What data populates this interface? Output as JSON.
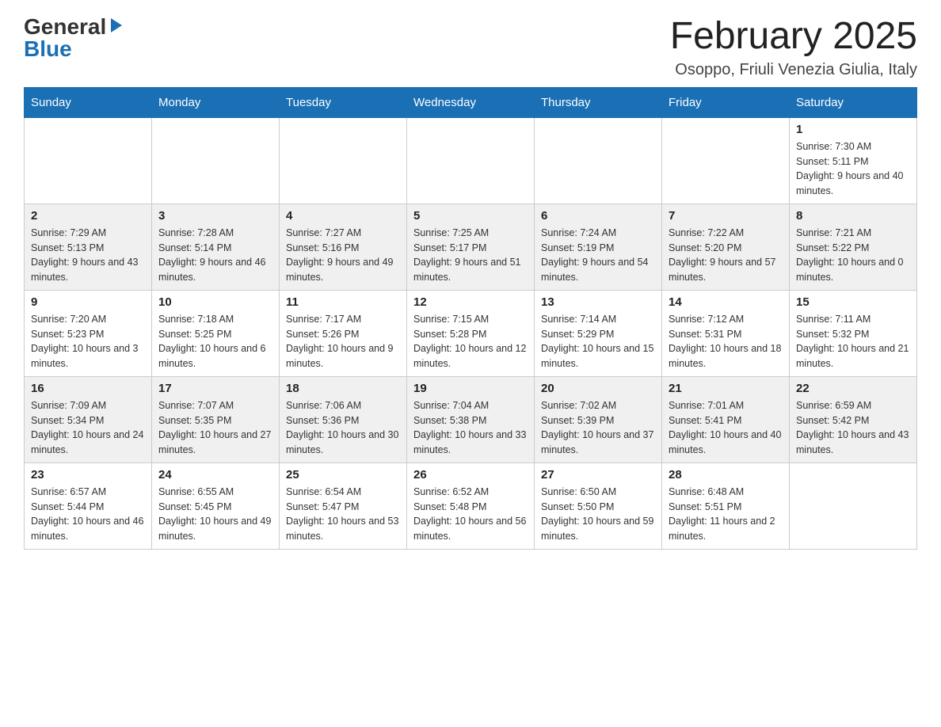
{
  "logo": {
    "general": "General",
    "blue": "Blue",
    "arrow": "▶"
  },
  "title": "February 2025",
  "subtitle": "Osoppo, Friuli Venezia Giulia, Italy",
  "headers": [
    "Sunday",
    "Monday",
    "Tuesday",
    "Wednesday",
    "Thursday",
    "Friday",
    "Saturday"
  ],
  "weeks": [
    [
      {
        "day": "",
        "info": ""
      },
      {
        "day": "",
        "info": ""
      },
      {
        "day": "",
        "info": ""
      },
      {
        "day": "",
        "info": ""
      },
      {
        "day": "",
        "info": ""
      },
      {
        "day": "",
        "info": ""
      },
      {
        "day": "1",
        "info": "Sunrise: 7:30 AM\nSunset: 5:11 PM\nDaylight: 9 hours and 40 minutes."
      }
    ],
    [
      {
        "day": "2",
        "info": "Sunrise: 7:29 AM\nSunset: 5:13 PM\nDaylight: 9 hours and 43 minutes."
      },
      {
        "day": "3",
        "info": "Sunrise: 7:28 AM\nSunset: 5:14 PM\nDaylight: 9 hours and 46 minutes."
      },
      {
        "day": "4",
        "info": "Sunrise: 7:27 AM\nSunset: 5:16 PM\nDaylight: 9 hours and 49 minutes."
      },
      {
        "day": "5",
        "info": "Sunrise: 7:25 AM\nSunset: 5:17 PM\nDaylight: 9 hours and 51 minutes."
      },
      {
        "day": "6",
        "info": "Sunrise: 7:24 AM\nSunset: 5:19 PM\nDaylight: 9 hours and 54 minutes."
      },
      {
        "day": "7",
        "info": "Sunrise: 7:22 AM\nSunset: 5:20 PM\nDaylight: 9 hours and 57 minutes."
      },
      {
        "day": "8",
        "info": "Sunrise: 7:21 AM\nSunset: 5:22 PM\nDaylight: 10 hours and 0 minutes."
      }
    ],
    [
      {
        "day": "9",
        "info": "Sunrise: 7:20 AM\nSunset: 5:23 PM\nDaylight: 10 hours and 3 minutes."
      },
      {
        "day": "10",
        "info": "Sunrise: 7:18 AM\nSunset: 5:25 PM\nDaylight: 10 hours and 6 minutes."
      },
      {
        "day": "11",
        "info": "Sunrise: 7:17 AM\nSunset: 5:26 PM\nDaylight: 10 hours and 9 minutes."
      },
      {
        "day": "12",
        "info": "Sunrise: 7:15 AM\nSunset: 5:28 PM\nDaylight: 10 hours and 12 minutes."
      },
      {
        "day": "13",
        "info": "Sunrise: 7:14 AM\nSunset: 5:29 PM\nDaylight: 10 hours and 15 minutes."
      },
      {
        "day": "14",
        "info": "Sunrise: 7:12 AM\nSunset: 5:31 PM\nDaylight: 10 hours and 18 minutes."
      },
      {
        "day": "15",
        "info": "Sunrise: 7:11 AM\nSunset: 5:32 PM\nDaylight: 10 hours and 21 minutes."
      }
    ],
    [
      {
        "day": "16",
        "info": "Sunrise: 7:09 AM\nSunset: 5:34 PM\nDaylight: 10 hours and 24 minutes."
      },
      {
        "day": "17",
        "info": "Sunrise: 7:07 AM\nSunset: 5:35 PM\nDaylight: 10 hours and 27 minutes."
      },
      {
        "day": "18",
        "info": "Sunrise: 7:06 AM\nSunset: 5:36 PM\nDaylight: 10 hours and 30 minutes."
      },
      {
        "day": "19",
        "info": "Sunrise: 7:04 AM\nSunset: 5:38 PM\nDaylight: 10 hours and 33 minutes."
      },
      {
        "day": "20",
        "info": "Sunrise: 7:02 AM\nSunset: 5:39 PM\nDaylight: 10 hours and 37 minutes."
      },
      {
        "day": "21",
        "info": "Sunrise: 7:01 AM\nSunset: 5:41 PM\nDaylight: 10 hours and 40 minutes."
      },
      {
        "day": "22",
        "info": "Sunrise: 6:59 AM\nSunset: 5:42 PM\nDaylight: 10 hours and 43 minutes."
      }
    ],
    [
      {
        "day": "23",
        "info": "Sunrise: 6:57 AM\nSunset: 5:44 PM\nDaylight: 10 hours and 46 minutes."
      },
      {
        "day": "24",
        "info": "Sunrise: 6:55 AM\nSunset: 5:45 PM\nDaylight: 10 hours and 49 minutes."
      },
      {
        "day": "25",
        "info": "Sunrise: 6:54 AM\nSunset: 5:47 PM\nDaylight: 10 hours and 53 minutes."
      },
      {
        "day": "26",
        "info": "Sunrise: 6:52 AM\nSunset: 5:48 PM\nDaylight: 10 hours and 56 minutes."
      },
      {
        "day": "27",
        "info": "Sunrise: 6:50 AM\nSunset: 5:50 PM\nDaylight: 10 hours and 59 minutes."
      },
      {
        "day": "28",
        "info": "Sunrise: 6:48 AM\nSunset: 5:51 PM\nDaylight: 11 hours and 2 minutes."
      },
      {
        "day": "",
        "info": ""
      }
    ]
  ]
}
